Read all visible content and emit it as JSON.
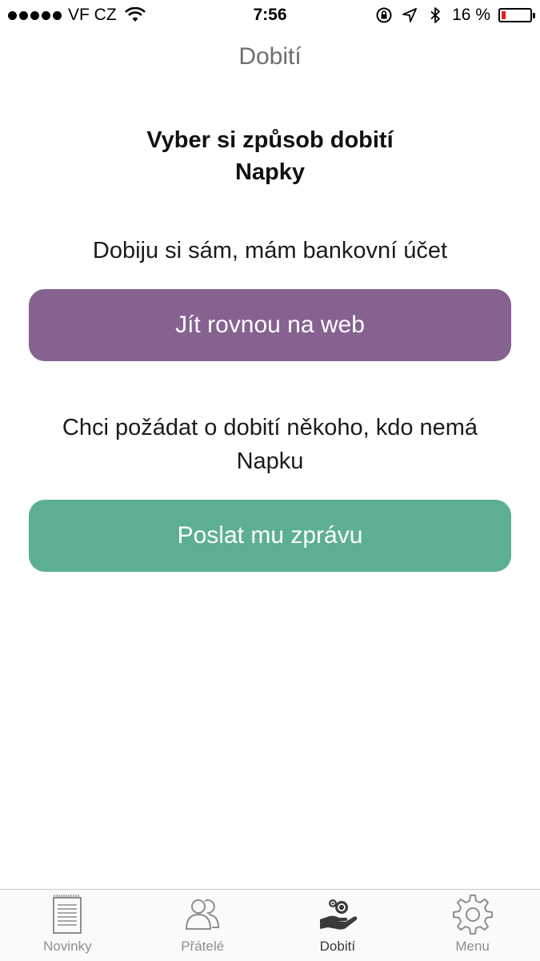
{
  "status_bar": {
    "carrier": "VF CZ",
    "time": "7:56",
    "battery_percent": "16 %",
    "battery_level": 0.16
  },
  "header": {
    "title": "Dobití"
  },
  "main": {
    "heading_line1": "Vyber si způsob dobití",
    "heading_line2": "Napky",
    "option1_text": "Dobiju si sám, mám bankovní účet",
    "option1_button": "Jít rovnou na web",
    "option2_text_line1": "Chci požádat o dobití někoho, kdo nemá",
    "option2_text_line2": "Napku",
    "option2_button": "Poslat mu zprávu"
  },
  "tab_bar": {
    "tabs": [
      {
        "label": "Novinky",
        "icon": "news-icon"
      },
      {
        "label": "Přátelé",
        "icon": "friends-icon"
      },
      {
        "label": "Dobití",
        "icon": "top-up-icon",
        "active": true
      },
      {
        "label": "Menu",
        "icon": "gear-icon"
      }
    ]
  },
  "colors": {
    "web_button": "#866290",
    "message_button": "#5daf94",
    "battery_low": "#e0231f"
  }
}
